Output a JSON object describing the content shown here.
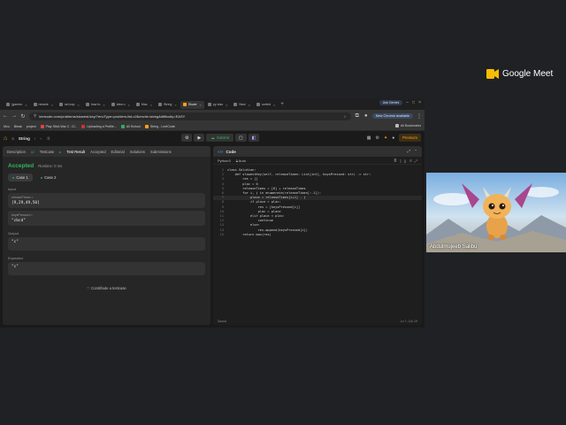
{
  "browser": {
    "tabs": [
      {
        "label": "(gameo",
        "active": false
      },
      {
        "label": "newsle",
        "active": false
      },
      {
        "label": "sel.cop",
        "active": false
      },
      {
        "label": "how to",
        "active": false
      },
      {
        "label": "idea o",
        "active": false
      },
      {
        "label": "Mac",
        "active": false
      },
      {
        "label": "String",
        "active": false
      },
      {
        "label": "Slowe",
        "active": true
      },
      {
        "label": "py clas",
        "active": false
      },
      {
        "label": "New",
        "active": false
      },
      {
        "label": "sorted",
        "active": false
      }
    ],
    "ask_gemini": "Ask Gemini",
    "url": "leetcode.com/problems/slowest-key/?envType=problem-list-v2&envId=string&difficulty=EASY",
    "update_label": "New Chrome available",
    "bookmarks": [
      "Bleak",
      "project",
      "Play Stick War 2 - Cl...",
      "Uploading a Profile...",
      "All School",
      "String - LeetCode"
    ],
    "bookmarks_prefix": "Mxu",
    "all_bookmarks": "All Bookmarks"
  },
  "leetcode": {
    "problem_list": "String",
    "submit": "Submit",
    "premium": "Premium",
    "left_tabs": [
      "Description",
      "Testcase",
      "Test Result",
      "Accepted",
      "Editorial",
      "Solutions",
      "Submissions"
    ],
    "status": "Accepted",
    "runtime": "Runtime: 0 ms",
    "cases": [
      "Case 1",
      "Case 2"
    ],
    "input_label": "Input",
    "param1_name": "releaseTimes =",
    "param1_value": "[9,29,49,50]",
    "param2_name": "keysPressed =",
    "param2_value": "\"cbcd\"",
    "output_label": "Output",
    "output_value": "\"c\"",
    "expected_label": "Expected",
    "expected_value": "\"c\"",
    "contribute": "Contribute a testcase",
    "code_title": "Code",
    "language": "Python3",
    "auto": "Auto",
    "code_lines": [
      "class Solution:",
      "    def slowestKey(self, releaseTimes: List[int], keysPressed: str) -> str:",
      "        res = []",
      "        plac = 0",
      "        releaseTimes = [0] + releaseTimes",
      "        for i, j in enumerate(releaseTimes[:-1]):",
      "            place = releaseTimes[i+1] - j",
      "            if place > plac:",
      "                res = [keysPressed[i]]",
      "                plac = place",
      "            elif place < plac:",
      "                continue",
      "            else:",
      "                res.append(keysPressed[i])",
      "        return max(res)"
    ],
    "status_left": "Saved",
    "status_right": "Ln 7, Col 19"
  },
  "meet": {
    "brand": "Google Meet",
    "participant": "Abdulmujeeb Salibu"
  }
}
